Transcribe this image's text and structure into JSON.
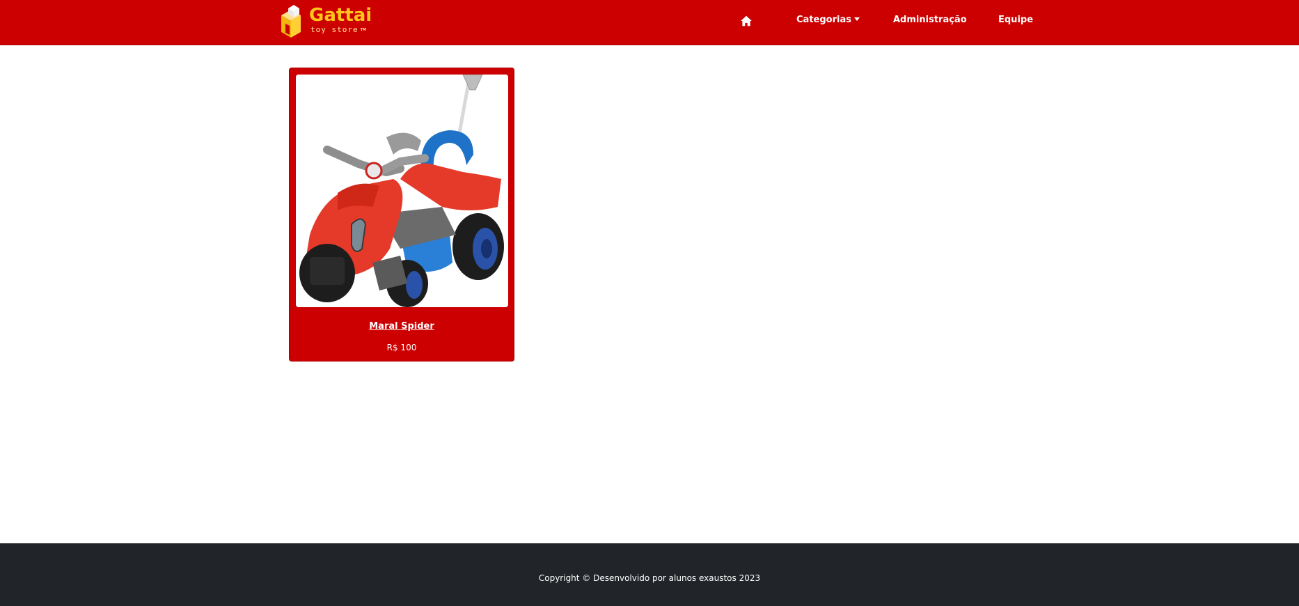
{
  "brand": {
    "name": "Gattai",
    "tagline": "toy store",
    "trademark": "TM",
    "primary_color": "#cc0000",
    "accent_color": "#ffc51a"
  },
  "nav": {
    "home_icon": "home-icon",
    "categories_label": "Categorias",
    "admin_label": "Administração",
    "team_label": "Equipe"
  },
  "products": [
    {
      "name": "Maral Spider",
      "price": "R$ 100",
      "image": "red-blue-toy-quad-bike"
    }
  ],
  "footer": {
    "text": "Copyright © Desenvolvido por alunos exaustos 2023",
    "background": "#212529"
  }
}
